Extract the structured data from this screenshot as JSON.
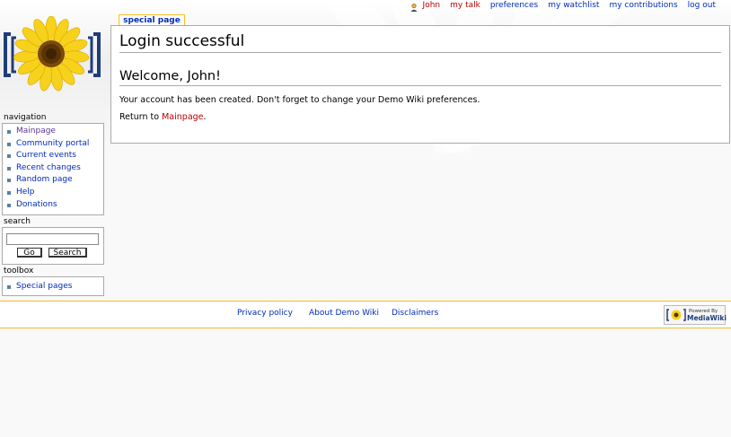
{
  "personal_tools": {
    "user": "John",
    "my_talk": "my talk",
    "preferences": "preferences",
    "my_watchlist": "my watchlist",
    "my_contributions": "my contributions",
    "log_out": "log out"
  },
  "tab": {
    "label": "special page"
  },
  "content": {
    "heading": "Login successful",
    "subheading": "Welcome, John!",
    "message": "Your account has been created. Don't forget to change your Demo Wiki preferences.",
    "return_prefix": "Return to ",
    "return_link": "Mainpage",
    "return_suffix": "."
  },
  "navigation": {
    "title": "navigation",
    "items": [
      {
        "label": "Mainpage"
      },
      {
        "label": "Community portal"
      },
      {
        "label": "Current events"
      },
      {
        "label": "Recent changes"
      },
      {
        "label": "Random page"
      },
      {
        "label": "Help"
      },
      {
        "label": "Donations"
      }
    ]
  },
  "search": {
    "title": "search",
    "value": "",
    "go_label": "Go",
    "search_label": "Search"
  },
  "toolbox": {
    "title": "toolbox",
    "items": [
      {
        "label": "Special pages"
      }
    ]
  },
  "footer": {
    "privacy": "Privacy policy",
    "about": "About Demo Wiki",
    "disclaimers": "Disclaimers",
    "powered_by_line1": "Powered By",
    "powered_by_line2": "MediaWiki"
  },
  "colors": {
    "link": "#002bb8",
    "visited_or_new_link": "#ba0000",
    "accent_border": "#fabd23",
    "portlet_bullet": "#5a7fa6"
  },
  "icons": {
    "user": "user-icon",
    "logo": "sunflower-logo",
    "powered_by": "mediawiki-badge"
  }
}
